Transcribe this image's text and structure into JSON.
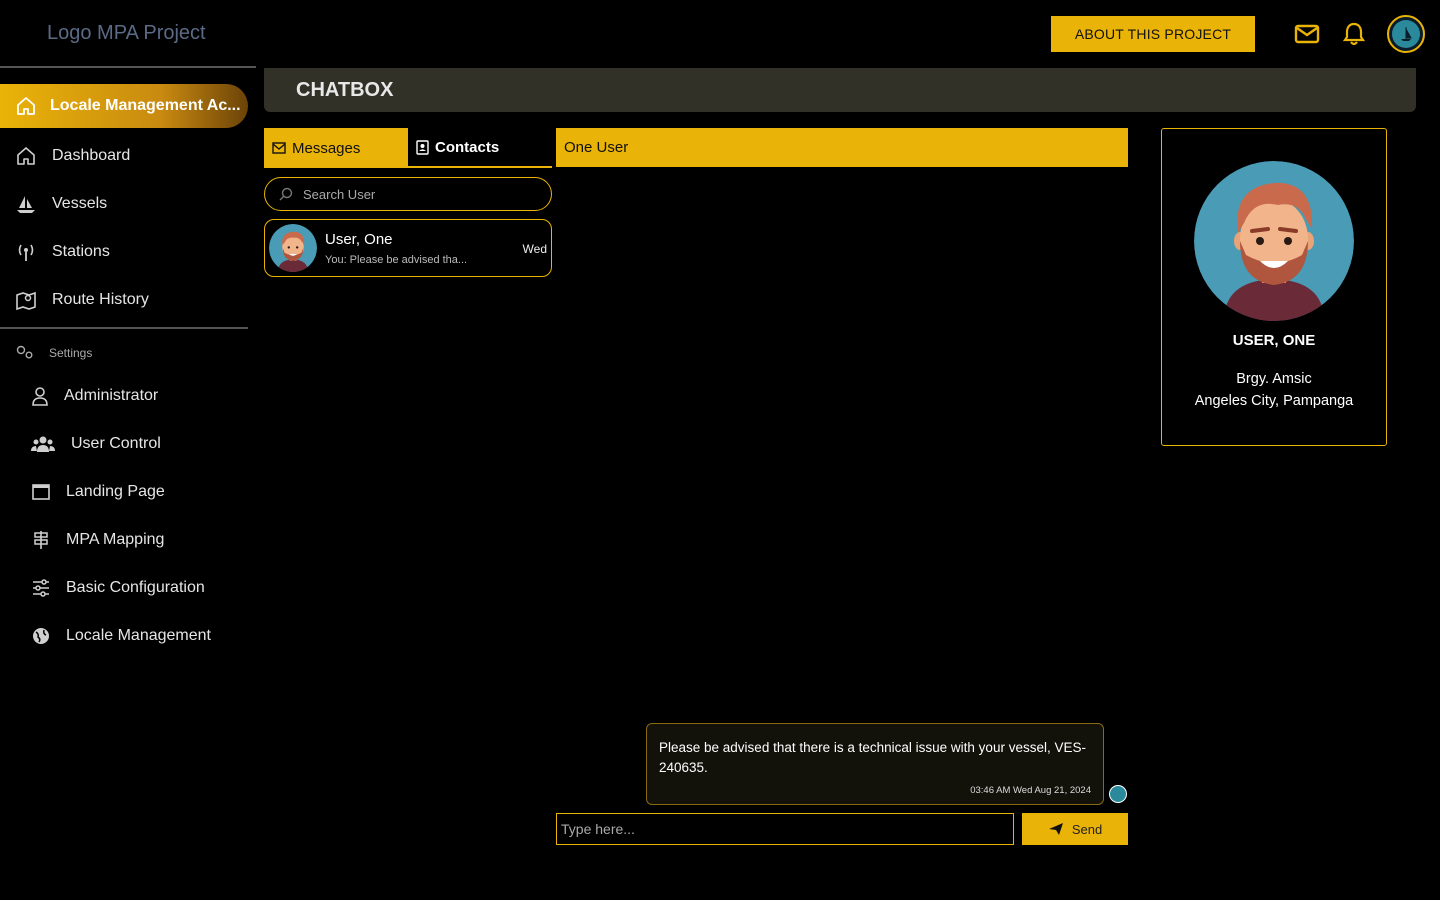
{
  "app": {
    "logo_text": "Logo MPA Project",
    "about_button": "ABOUT THIS PROJECT"
  },
  "colors": {
    "accent": "#eab308",
    "background": "#000000",
    "header_bar": "#313128"
  },
  "sidebar": {
    "active_item": {
      "label": "Locale Management Ac...",
      "icon": "home-icon"
    },
    "items": [
      {
        "label": "Dashboard",
        "icon": "home-icon"
      },
      {
        "label": "Vessels",
        "icon": "sailboat-icon"
      },
      {
        "label": "Stations",
        "icon": "antenna-icon"
      },
      {
        "label": "Route History",
        "icon": "map-pin-icon"
      }
    ],
    "settings_label": "Settings",
    "settings_items": [
      {
        "label": "Administrator",
        "icon": "user-icon"
      },
      {
        "label": "User Control",
        "icon": "users-icon"
      },
      {
        "label": "Landing Page",
        "icon": "window-icon"
      },
      {
        "label": "MPA Mapping",
        "icon": "signpost-icon"
      },
      {
        "label": "Basic Configuration",
        "icon": "sliders-icon"
      },
      {
        "label": "Locale Management",
        "icon": "globe-icon"
      }
    ]
  },
  "page": {
    "title": "CHATBOX"
  },
  "tabs": {
    "messages": "Messages",
    "contacts": "Contacts"
  },
  "search": {
    "placeholder": "Search User"
  },
  "contacts": [
    {
      "name": "User, One",
      "preview": "You: Please be advised tha...",
      "day": "Wed"
    }
  ],
  "chat": {
    "header": "One User",
    "messages": [
      {
        "text": "Please be advised that there is a technical issue with your vessel, VES-240635.",
        "time": "03:46 AM Wed Aug 21, 2024"
      }
    ],
    "input_placeholder": "Type here...",
    "send_label": "Send"
  },
  "profile": {
    "name": "USER, ONE",
    "address_line1": "Brgy. Amsic",
    "address_line2": "Angeles City, Pampanga"
  }
}
